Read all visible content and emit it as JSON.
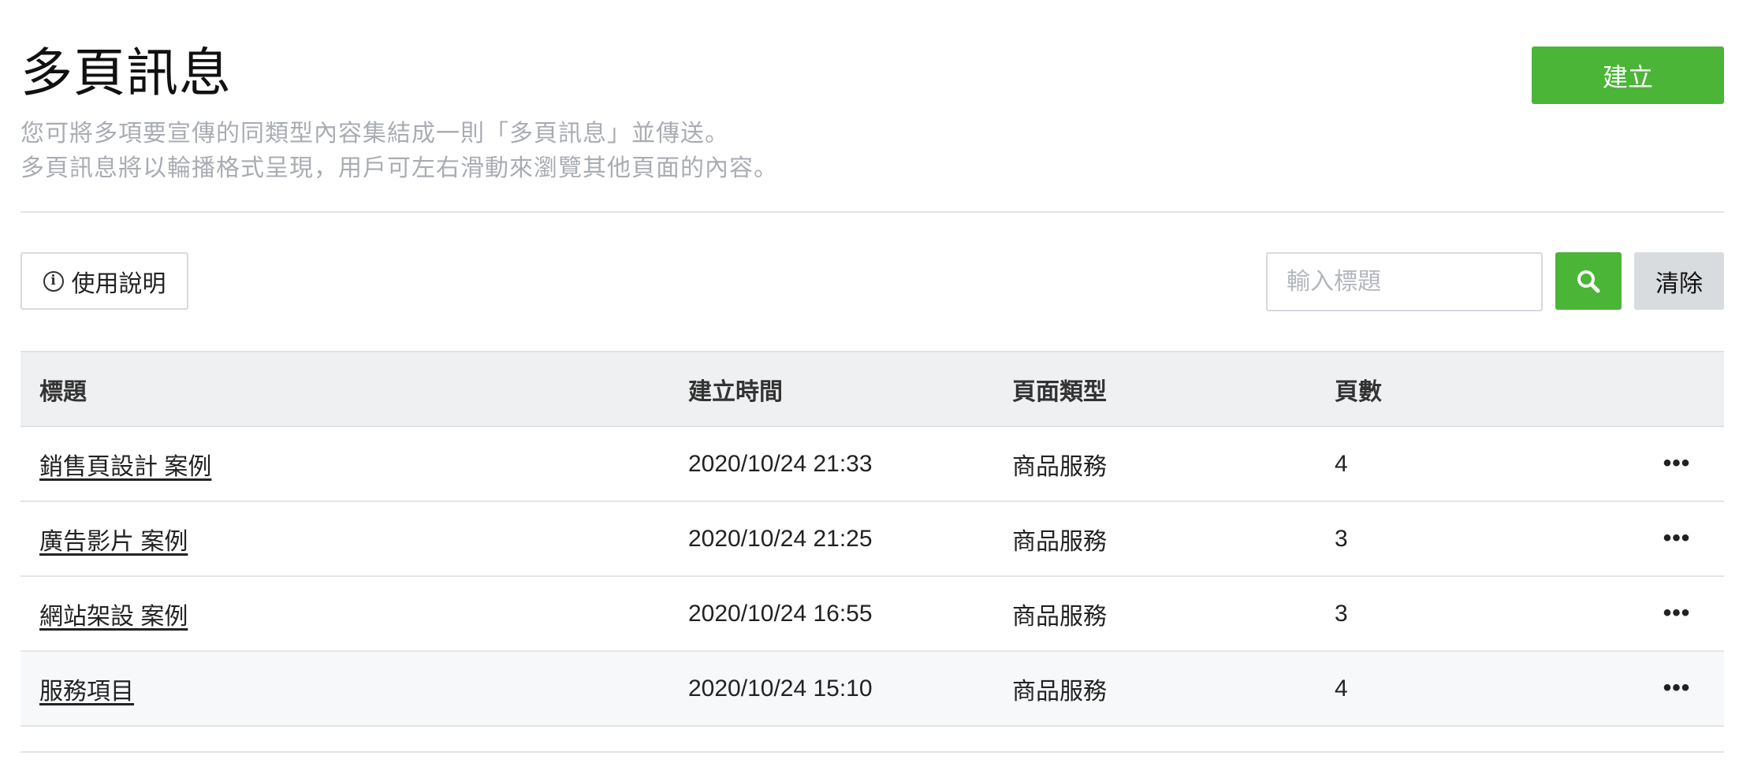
{
  "page": {
    "title": "多頁訊息",
    "description_line1": "您可將多項要宣傳的同類型內容集結成一則「多頁訊息」並傳送。",
    "description_line2": "多頁訊息將以輪播格式呈現，用戶可左右滑動來瀏覽其他頁面的內容。",
    "create_label": "建立"
  },
  "toolbar": {
    "help_label": "使用說明",
    "help_icon": "info-icon",
    "search_placeholder": "輸入標題",
    "search_value": "",
    "search_icon": "search-icon",
    "clear_label": "清除"
  },
  "table": {
    "headers": [
      "標題",
      "建立時間",
      "頁面類型",
      "頁數"
    ],
    "rows": [
      {
        "title": "銷售頁設計 案例",
        "created": "2020/10/24 21:33",
        "type": "商品服務",
        "pages": "4",
        "menu": "•••"
      },
      {
        "title": "廣告影片 案例",
        "created": "2020/10/24 21:25",
        "type": "商品服務",
        "pages": "3",
        "menu": "•••"
      },
      {
        "title": "網站架設 案例",
        "created": "2020/10/24 16:55",
        "type": "商品服務",
        "pages": "3",
        "menu": "•••"
      },
      {
        "title": "服務項目",
        "created": "2020/10/24 15:10",
        "type": "商品服務",
        "pages": "4",
        "menu": "•••"
      }
    ]
  },
  "colors": {
    "accent_green": "#4bb537",
    "muted_text": "#a9adb3",
    "header_bg": "#eff0f2",
    "clear_bg": "#d9dcdf"
  }
}
